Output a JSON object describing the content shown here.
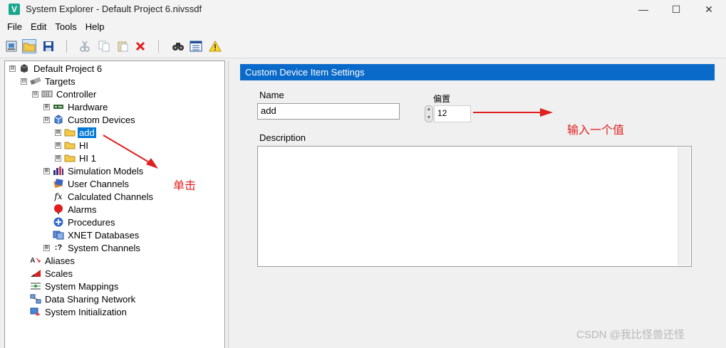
{
  "window": {
    "title": "System Explorer - Default Project 6.nivssdf",
    "app_icon_letter": "V",
    "minimize_glyph": "—",
    "maximize_glyph": "☐",
    "close_glyph": "✕"
  },
  "menu": [
    "File",
    "Edit",
    "Tools",
    "Help"
  ],
  "toolbar": {
    "icons": [
      "new-project-icon",
      "open-folder-icon",
      "save-icon",
      "cut-icon",
      "copy-icon",
      "paste-icon",
      "delete-icon",
      "find-icon",
      "properties-icon",
      "warning-icon"
    ]
  },
  "tree": {
    "items": [
      {
        "label": "Default Project 6",
        "expander": "⊟",
        "icon": "project-icon"
      },
      {
        "label": "Targets",
        "expander": "⊟",
        "icon": "targets-icon"
      },
      {
        "label": "Controller",
        "expander": "⊟",
        "icon": "controller-icon"
      },
      {
        "label": "Hardware",
        "expander": "⊞",
        "icon": "hardware-icon"
      },
      {
        "label": "Custom Devices",
        "expander": "⊟",
        "icon": "custom-devices-icon"
      },
      {
        "label": "add",
        "expander": "⊞",
        "icon": "folder-icon",
        "selected": true
      },
      {
        "label": "HI",
        "expander": "⊞",
        "icon": "folder-icon"
      },
      {
        "label": "HI 1",
        "expander": "⊞",
        "icon": "folder-icon"
      },
      {
        "label": "Simulation Models",
        "expander": "⊞",
        "icon": "simulation-models-icon"
      },
      {
        "label": "User Channels",
        "expander": "",
        "icon": "user-channels-icon"
      },
      {
        "label": "Calculated Channels",
        "expander": "",
        "icon": "fx-icon"
      },
      {
        "label": "Alarms",
        "expander": "",
        "icon": "alarm-icon"
      },
      {
        "label": "Procedures",
        "expander": "",
        "icon": "procedures-icon"
      },
      {
        "label": "XNET Databases",
        "expander": "",
        "icon": "database-icon"
      },
      {
        "label": "System Channels",
        "expander": "⊞",
        "icon": "system-channels-icon"
      },
      {
        "label": "Aliases",
        "expander": "",
        "icon": "aliases-icon"
      },
      {
        "label": "Scales",
        "expander": "",
        "icon": "scales-icon"
      },
      {
        "label": "System Mappings",
        "expander": "",
        "icon": "mappings-icon"
      },
      {
        "label": "Data Sharing Network",
        "expander": "",
        "icon": "network-icon"
      },
      {
        "label": "System Initialization",
        "expander": "",
        "icon": "initialization-icon"
      }
    ]
  },
  "settings": {
    "header": "Custom Device Item Settings",
    "name_label": "Name",
    "name_value": "add",
    "offset_label": "偏置",
    "offset_value": "12",
    "description_label": "Description",
    "description_value": ""
  },
  "annotations": {
    "click_note": "单击",
    "input_note": "输入一个值",
    "color": "#e02020"
  },
  "watermark": "CSDN @我比怪兽还怪",
  "colors": {
    "accent": "#0a6ac9",
    "selection": "#0078d7"
  }
}
